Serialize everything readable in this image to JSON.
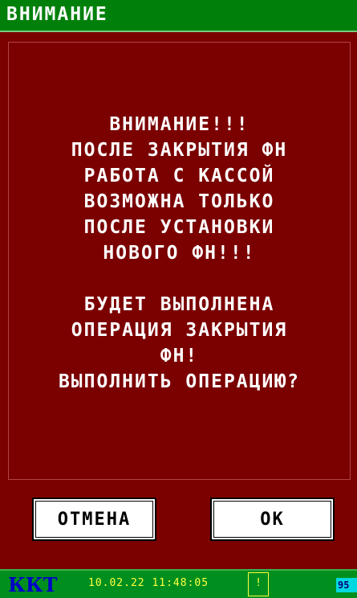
{
  "window": {
    "title": "ВНИМАНИЕ"
  },
  "message": {
    "lines": [
      "ВНИМАНИЕ!!!",
      "ПОСЛЕ ЗАКРЫТИЯ ФН",
      "РАБОТА С КАССОЙ",
      "ВОЗМОЖНА ТОЛЬКО",
      "ПОСЛЕ УСТАНОВКИ",
      "НОВОГО ФН!!!",
      "БУДЕТ ВЫПОЛНЕНА",
      "ОПЕРАЦИЯ ЗАКРЫТИЯ",
      "ФН!",
      "ВЫПОЛНИТЬ ОПЕРАЦИЮ?"
    ]
  },
  "buttons": {
    "cancel_label": "ОТМЕНА",
    "ok_label": "ОК"
  },
  "status": {
    "device_name": "ККТ",
    "datetime": "10.02.22 11:48:05",
    "indicator": "!",
    "battery": "95"
  },
  "colors": {
    "background": "#7b0000",
    "titlebar": "#00800b",
    "statusbar": "#008f1e",
    "device_name": "#0000c8",
    "datetime": "#ffff40",
    "battery": "#00d8e0"
  }
}
